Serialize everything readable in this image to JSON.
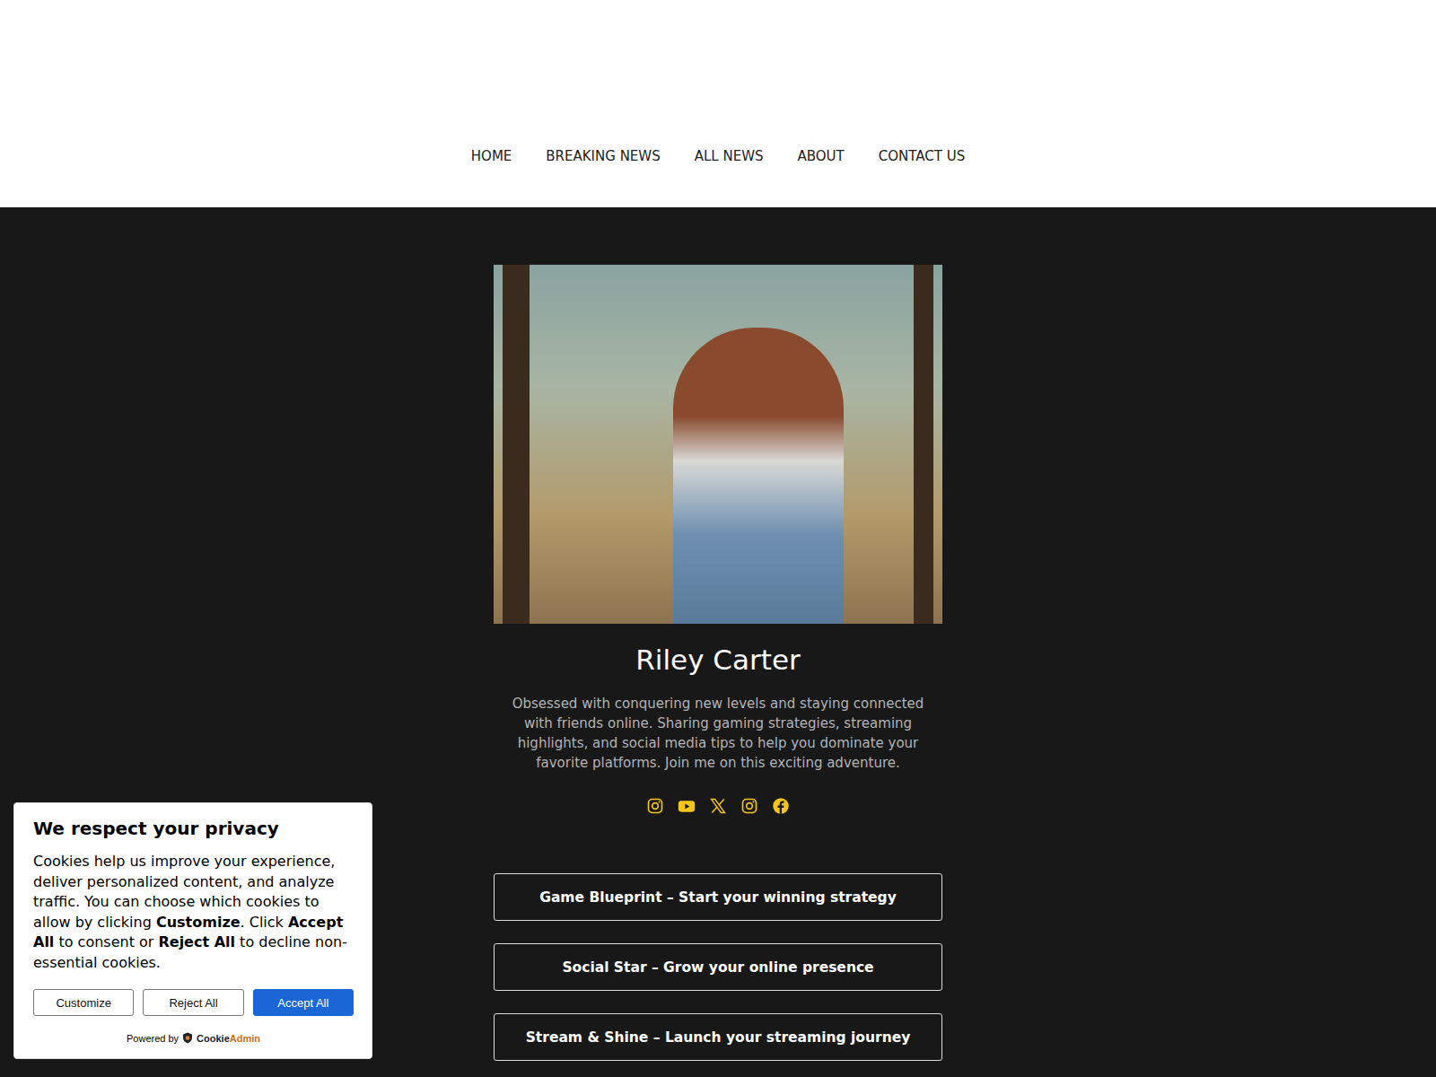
{
  "nav": [
    {
      "label": "HOME"
    },
    {
      "label": "BREAKING NEWS"
    },
    {
      "label": "ALL NEWS"
    },
    {
      "label": "ABOUT"
    },
    {
      "label": "CONTACT US"
    }
  ],
  "profile": {
    "name": "Riley Carter",
    "bio": "Obsessed with conquering new levels and staying connected with friends online. Sharing gaming strategies, streaming highlights, and social media tips to help you dominate your favorite platforms. Join me on this exciting adventure."
  },
  "socials": [
    {
      "kind": "instagram"
    },
    {
      "kind": "youtube"
    },
    {
      "kind": "x"
    },
    {
      "kind": "instagram"
    },
    {
      "kind": "facebook"
    }
  ],
  "links": [
    {
      "label": "Game Blueprint – Start your winning strategy"
    },
    {
      "label": "Social Star – Grow your online presence"
    },
    {
      "label": "Stream & Shine – Launch your streaming journey"
    }
  ],
  "cookie": {
    "title": "We respect your privacy",
    "body": [
      {
        "text": "Cookies help us improve your experience, deliver personalized content, and analyze traffic. You can choose which cookies to allow by clicking ",
        "bold": false
      },
      {
        "text": "Customize",
        "bold": true
      },
      {
        "text": ". Click ",
        "bold": false
      },
      {
        "text": "Accept All",
        "bold": true
      },
      {
        "text": " to consent or ",
        "bold": false
      },
      {
        "text": "Reject All",
        "bold": true
      },
      {
        "text": " to decline non-essential cookies.",
        "bold": false
      }
    ],
    "buttons": [
      {
        "label": "Customize",
        "primary": false
      },
      {
        "label": "Reject All",
        "primary": false
      },
      {
        "label": "Accept All",
        "primary": true
      }
    ],
    "powered": "Powered by",
    "brand_first": "Cookie",
    "brand_second": "Admin"
  }
}
